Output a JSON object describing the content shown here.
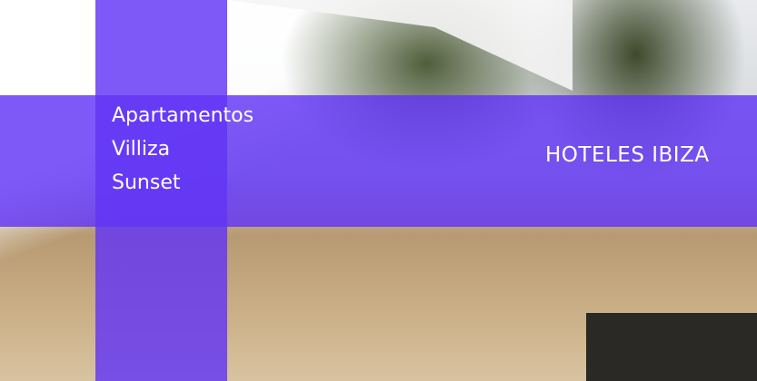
{
  "hotel": {
    "name_lines": [
      "Apartamentos",
      "Villiza",
      "Sunset"
    ]
  },
  "brand": {
    "label": "HOTELES IBIZA"
  },
  "colors": {
    "overlay": "#6234f5",
    "text": "#ffffff"
  }
}
